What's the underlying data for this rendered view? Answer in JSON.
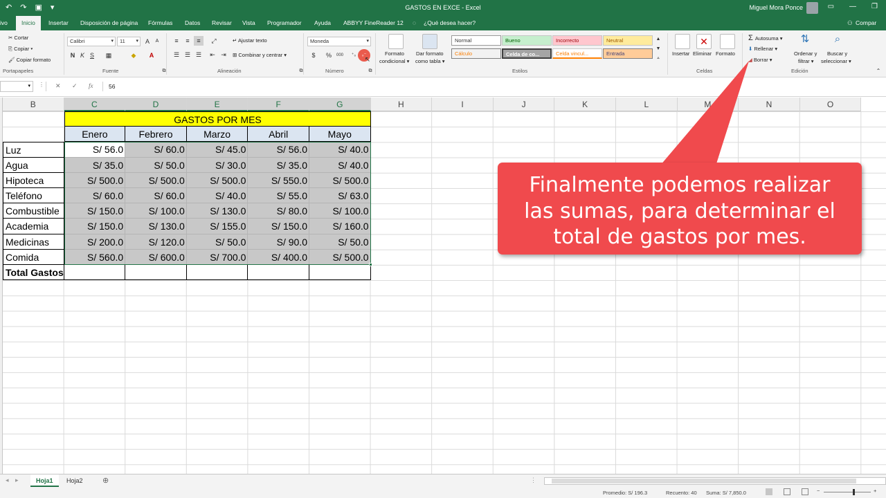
{
  "window": {
    "title": "GASTOS EN EXCE  -  Excel",
    "user": "Miguel Mora Ponce"
  },
  "tabs": [
    "ivo",
    "Inicio",
    "Insertar",
    "Disposición de página",
    "Fórmulas",
    "Datos",
    "Revisar",
    "Vista",
    "Programador",
    "Ayuda",
    "ABBYY FineReader 12",
    "¿Qué desea hacer?",
    "Compar"
  ],
  "ribbon": {
    "clipboard": {
      "cut": "Cortar",
      "copy": "Copiar",
      "format_painter": "Copiar formato",
      "label": "Portapapeles"
    },
    "font": {
      "name": "Calibri",
      "size": "11",
      "bold": "N",
      "italic": "K",
      "underline": "S",
      "label": "Fuente"
    },
    "alignment": {
      "wrap": "Ajustar texto",
      "merge": "Combinar y centrar",
      "label": "Alineación"
    },
    "number": {
      "format": "Moneda",
      "percent": "%",
      "thousands": "000",
      "label": "Número"
    },
    "styles": {
      "cond_format_1": "Formato",
      "cond_format_2": "condicional",
      "table_format_1": "Dar formato",
      "table_format_2": "como tabla",
      "normal": "Normal",
      "bueno": "Bueno",
      "incorrecto": "Incorrecto",
      "neutral": "Neutral",
      "calculo": "Cálculo",
      "celda_control": "Celda de co...",
      "celda_vinculada": "Celda vincul...",
      "entrada": "Entrada",
      "label": "Estilos"
    },
    "cells": {
      "insert": "Insertar",
      "delete": "Eliminar",
      "format": "Formato",
      "label": "Celdas"
    },
    "editing": {
      "autosum": "Autosuma",
      "fill": "Rellenar",
      "clear": "Borrar",
      "sort_1": "Ordenar y",
      "sort_2": "filtrar",
      "find_1": "Buscar y",
      "find_2": "seleccionar",
      "label": "Edición"
    }
  },
  "formula_bar": {
    "fx": "fx",
    "value": "56"
  },
  "columns": [
    "B",
    "C",
    "D",
    "E",
    "F",
    "G",
    "H",
    "I",
    "J",
    "K",
    "L",
    "M",
    "N",
    "O"
  ],
  "table": {
    "title": "GASTOS POR MES",
    "months": [
      "Enero",
      "Febrero",
      "Marzo",
      "Abril",
      "Mayo"
    ],
    "rows": [
      {
        "label": "Luz",
        "values": [
          "S/ 56.0",
          "S/ 60.0",
          "S/ 45.0",
          "S/ 56.0",
          "S/ 40.0"
        ]
      },
      {
        "label": "Agua",
        "values": [
          "S/ 35.0",
          "S/ 50.0",
          "S/ 30.0",
          "S/ 35.0",
          "S/ 40.0"
        ]
      },
      {
        "label": "Hipoteca",
        "values": [
          "S/ 500.0",
          "S/ 500.0",
          "S/ 500.0",
          "S/ 550.0",
          "S/ 500.0"
        ]
      },
      {
        "label": "Teléfono",
        "values": [
          "S/ 60.0",
          "S/ 60.0",
          "S/ 40.0",
          "S/ 55.0",
          "S/ 63.0"
        ]
      },
      {
        "label": "Combustible",
        "values": [
          "S/ 150.0",
          "S/ 100.0",
          "S/ 130.0",
          "S/ 80.0",
          "S/ 100.0"
        ]
      },
      {
        "label": "Academia",
        "values": [
          "S/ 150.0",
          "S/ 130.0",
          "S/ 155.0",
          "S/ 150.0",
          "S/ 160.0"
        ]
      },
      {
        "label": "Medicinas",
        "values": [
          "S/ 200.0",
          "S/ 120.0",
          "S/ 50.0",
          "S/ 90.0",
          "S/ 50.0"
        ]
      },
      {
        "label": "Comida",
        "values": [
          "S/ 560.0",
          "S/ 600.0",
          "S/ 700.0",
          "S/ 400.0",
          "S/ 500.0"
        ]
      }
    ],
    "total_label": "Total Gastos"
  },
  "callout": {
    "line1": "Finalmente podemos realizar",
    "line2": "las sumas, para determinar el",
    "line3": "total de gastos por mes."
  },
  "sheets": [
    "Hoja1",
    "Hoja2"
  ],
  "status": {
    "average": "Promedio: S/ 196.3",
    "count": "Recuento: 40",
    "sum": "Suma: S/ 7,850.0"
  },
  "colors": {
    "excel_green": "#217346",
    "header_yellow": "#ffff00",
    "month_blue": "#dbe5f1",
    "callout_red": "#f04a4d"
  }
}
